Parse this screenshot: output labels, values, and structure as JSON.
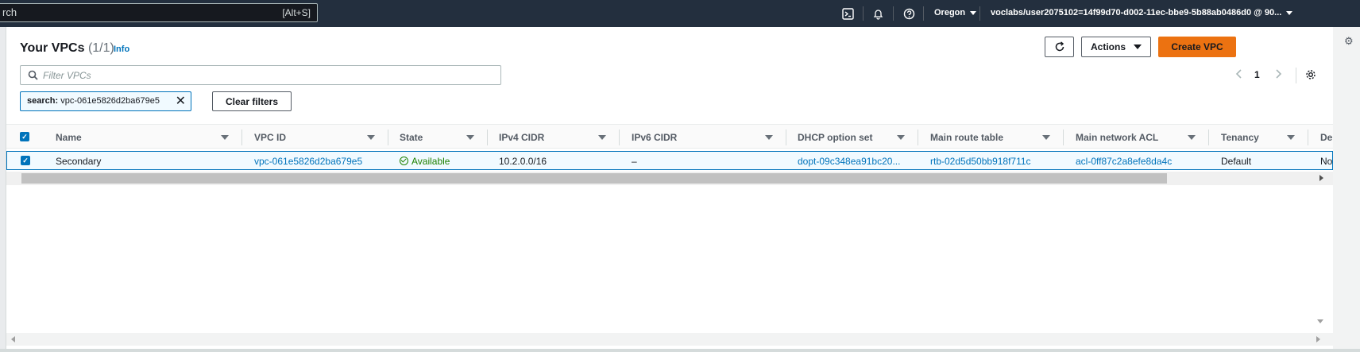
{
  "topnav": {
    "search_text": "rch",
    "search_shortcut": "[Alt+S]",
    "region": "Oregon",
    "account": "voclabs/user2075102=14f99d70-d002-11ec-bbe9-5b88ab0486d0 @ 90..."
  },
  "header": {
    "title": "Your VPCs",
    "count": "(1/1)",
    "info": "Info"
  },
  "toolbar": {
    "actions_label": "Actions",
    "create_label": "Create VPC",
    "filter_placeholder": "Filter VPCs",
    "token_key": "search:",
    "token_value": " vpc-061e5826d2ba679e5",
    "clear_filters_label": "Clear filters",
    "page_number": "1"
  },
  "table": {
    "columns": [
      "Name",
      "VPC ID",
      "State",
      "IPv4 CIDR",
      "IPv6 CIDR",
      "DHCP option set",
      "Main route table",
      "Main network ACL",
      "Tenancy",
      "De"
    ],
    "rows": [
      {
        "name": "Secondary",
        "vpc_id": "vpc-061e5826d2ba679e5",
        "state": "Available",
        "ipv4": "10.2.0.0/16",
        "ipv6": "–",
        "dhcp": "dopt-09c348ea91bc20...",
        "route_table": "rtb-02d5d50bb918f711c",
        "acl": "acl-0ff87c2a8efe8da4c",
        "tenancy": "Default",
        "default": "No"
      }
    ]
  },
  "colors": {
    "nav_bg": "#232f3e",
    "primary": "#ec7211",
    "link": "#0073bb",
    "success": "#1d8102"
  }
}
